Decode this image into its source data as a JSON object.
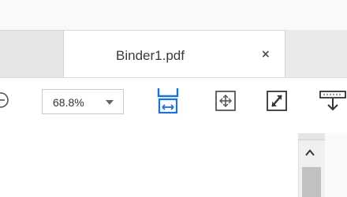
{
  "tabs": {
    "document_tab": {
      "title": "Binder1.pdf",
      "close_label": "×"
    }
  },
  "toolbar": {
    "zoom": {
      "value": "68.8%"
    },
    "tools": [
      {
        "name": "fit-width-icon",
        "color": "#1a73d9"
      },
      {
        "name": "fit-page-icon",
        "color": "#555555"
      },
      {
        "name": "full-screen-icon",
        "color": "#333333"
      },
      {
        "name": "download-icon",
        "color": "#333333"
      }
    ]
  },
  "scrollbar": {
    "up_arrow_icon": "chevron-up-icon"
  },
  "colors": {
    "accent": "#1a73d9",
    "tab_background": "#ebebeb",
    "active_tab": "#ffffff"
  }
}
